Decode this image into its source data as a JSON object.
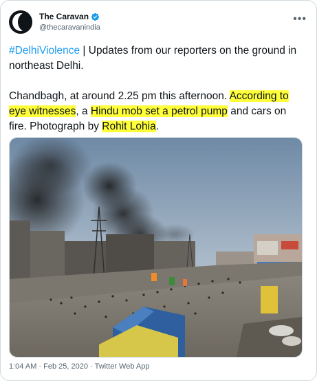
{
  "account": {
    "display_name": "The Caravan",
    "handle": "@thecaravanindia",
    "avatar_icon": "caravan-logo-icon",
    "verified_icon": "verified-badge-icon",
    "more_icon": "more-options-icon"
  },
  "tweet": {
    "p1": {
      "hashtag": "#DelhiViolence",
      "rest": " | Updates from our reporters on the ground in northeast Delhi."
    },
    "p2": {
      "s1": "Chandbagh, at around 2.25 pm this afternoon. ",
      "h1": "According to eye witnesses",
      "s2": ", a ",
      "h2": "Hindu mob set a petrol pump",
      "s3": " and cars on fire. Photograph by ",
      "h3": "Rohit Lohia",
      "s4": "."
    },
    "highlight_color": "#ffff3a",
    "link_color": "#1d9bf0"
  },
  "photo": {
    "description_icon": "street-smoke-photo"
  },
  "meta": {
    "time": "1:04 AM",
    "date": "Feb 25, 2020",
    "source": "Twitter Web App"
  }
}
